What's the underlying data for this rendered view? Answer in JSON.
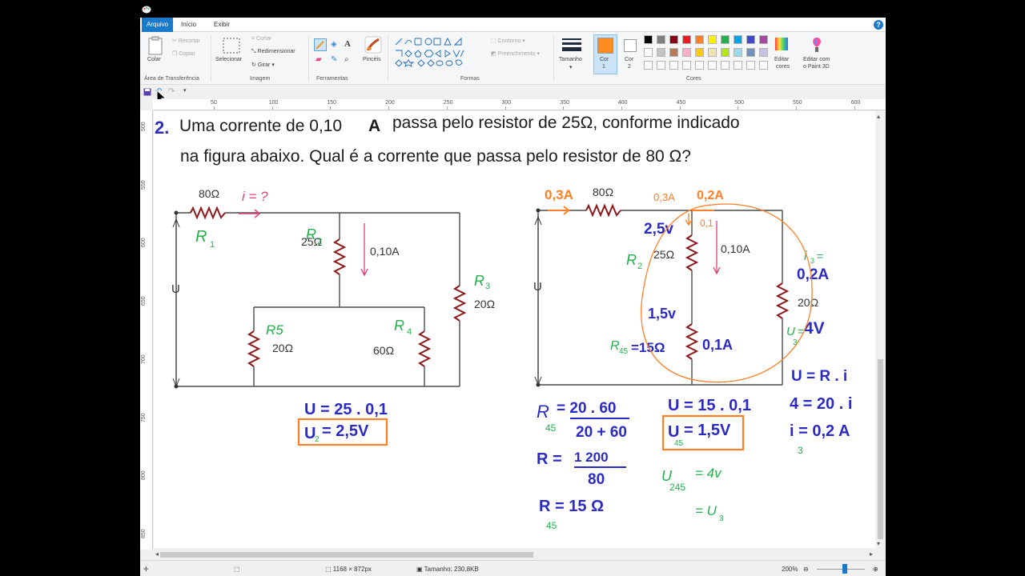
{
  "menu": {
    "tabs": [
      {
        "label": "Arquivo"
      },
      {
        "label": "Início"
      },
      {
        "label": "Exibir"
      }
    ],
    "help_label": "?"
  },
  "ribbon": {
    "clipboard": {
      "paste_label": "Colar",
      "cut_label": "Recortar",
      "copy_label": "Copiar",
      "group_label": "Área de Transferência"
    },
    "image": {
      "select_label": "Selecionar",
      "crop_label": "Cortar",
      "resize_label": "Redimensionar",
      "rotate_label": "Girar",
      "group_label": "Imagem"
    },
    "tools": {
      "group_label": "Ferramentas",
      "text_tool_glyph": "A"
    },
    "brushes_label": "Pincéis",
    "shapes": {
      "outline_label": "Contorno",
      "fill_label": "Preenchimento",
      "group_label": "Formas"
    },
    "size_label": "Tamanho",
    "color1_label": "Cor",
    "color1_index": "1",
    "color2_label": "Cor",
    "color2_index": "2",
    "colors_group_label": "Cores",
    "edit_colors_label_1": "Editar",
    "edit_colors_label_2": "cores",
    "paint3d_label_1": "Editar com",
    "paint3d_label_2": "o Paint 3D",
    "color1_value": "#ff8c21",
    "color2_value": "#ffffff",
    "palette_row1": [
      "#000000",
      "#7f7f7f",
      "#880015",
      "#ed1c24",
      "#ff7f27",
      "#fff200",
      "#22b14c",
      "#00a2e8",
      "#3f48cc",
      "#a349a4"
    ],
    "palette_row2": [
      "#ffffff",
      "#c3c3c3",
      "#b97a57",
      "#ffaec9",
      "#ffc90e",
      "#efe4b0",
      "#b5e61d",
      "#99d9ea",
      "#7092be",
      "#c8bfe7"
    ]
  },
  "rulers": {
    "horizontal": [
      "50",
      "100",
      "150",
      "200",
      "250",
      "300",
      "350",
      "400",
      "450",
      "500",
      "550",
      "600"
    ],
    "vertical": [
      "500",
      "550",
      "600",
      "650",
      "700",
      "750",
      "800",
      "850"
    ]
  },
  "drawing": {
    "question_number": "2.",
    "question_line1": "Uma corrente de 0,10",
    "question_line1_unit": "A",
    "question_line1_rest": "passa pelo resistor de 25Ω, conforme  indicado",
    "question_line2": "na figura abaixo. Qual é a corrente que passa pelo resistor de 80  Ω?",
    "left_circuit": {
      "r1_value": "80Ω",
      "r1_label": "R",
      "r1_sub": "1",
      "unknown_current": "i = ?",
      "r2_value": "25Ω",
      "r2_label": "R",
      "r2_sub": "2",
      "current_label": "0,10A",
      "r3_value": "20Ω",
      "r3_label": "R",
      "r3_sub": "3",
      "r5_value": "20Ω",
      "r5_label": "R5",
      "r4_value": "60Ω",
      "r4_label": "R",
      "r4_sub": "4",
      "voltage_label": "U"
    },
    "right_circuit": {
      "in_current": "0,3A",
      "r1_value": "80Ω",
      "branch_current_a": "0,3A",
      "branch_current_b": "0,2A",
      "branch_current_c": "0,1",
      "node_voltage": "2,5v",
      "r2_label": "R",
      "r2_sub": "2",
      "r2_value": "25Ω",
      "current_label": "0,10A",
      "r3_current_label": "i",
      "r3_current_sub": "3",
      "r3_current_eq": "=",
      "r3_current": "0,2A",
      "r3_value": "20Ω",
      "r3_voltage_label": "U",
      "r3_voltage_sub": "3",
      "r3_voltage_eq": "=",
      "r3_voltage": "4V",
      "lower_voltage": "1,5v",
      "r45_label": "R",
      "r45_sub": "45",
      "r45_value": "=15Ω",
      "lower_current": "0,1A",
      "voltage_label": "U"
    },
    "calc": {
      "u_eq": "U = 25 . 0,1",
      "u_result": "U",
      "u_result_sub": "2",
      "u_result_val": "= 2,5V",
      "r45_eq_label": "R",
      "r45_eq_sub": "45",
      "r45_eq_num": "= 20 . 60",
      "r45_eq_den": "20 + 60",
      "r_eq2_label": "R =",
      "r_eq2_num": "1 200",
      "r_eq2_den": "80",
      "r_eq3": "R = 15 Ω",
      "r_eq3_sub": "45",
      "u15_eq": "U = 15 . 0,1",
      "u15_result": "U",
      "u15_result_sub": "45",
      "u15_result_val": "= 1,5V",
      "u245_label": "U",
      "u245_sub": "245",
      "u245_val": "= 4v",
      "u3_eq": "= U",
      "u3_sub": "3",
      "ohm_eq1": "U = R . i",
      "ohm_eq2": "4 = 20 . i",
      "ohm_eq3": "i  = 0,2 A",
      "ohm_eq3_sub": "3"
    }
  },
  "status": {
    "dimensions": "1168 × 872px",
    "size": "Tamanho: 230,8KB",
    "zoom": "200%"
  },
  "colors": {
    "accent": "#1979ca",
    "ink_blue": "#2b2bc4",
    "ink_green": "#22b14c",
    "ink_orange": "#ff7f27",
    "ink_pink": "#e0407a",
    "resistor": "#8b1a1a"
  }
}
